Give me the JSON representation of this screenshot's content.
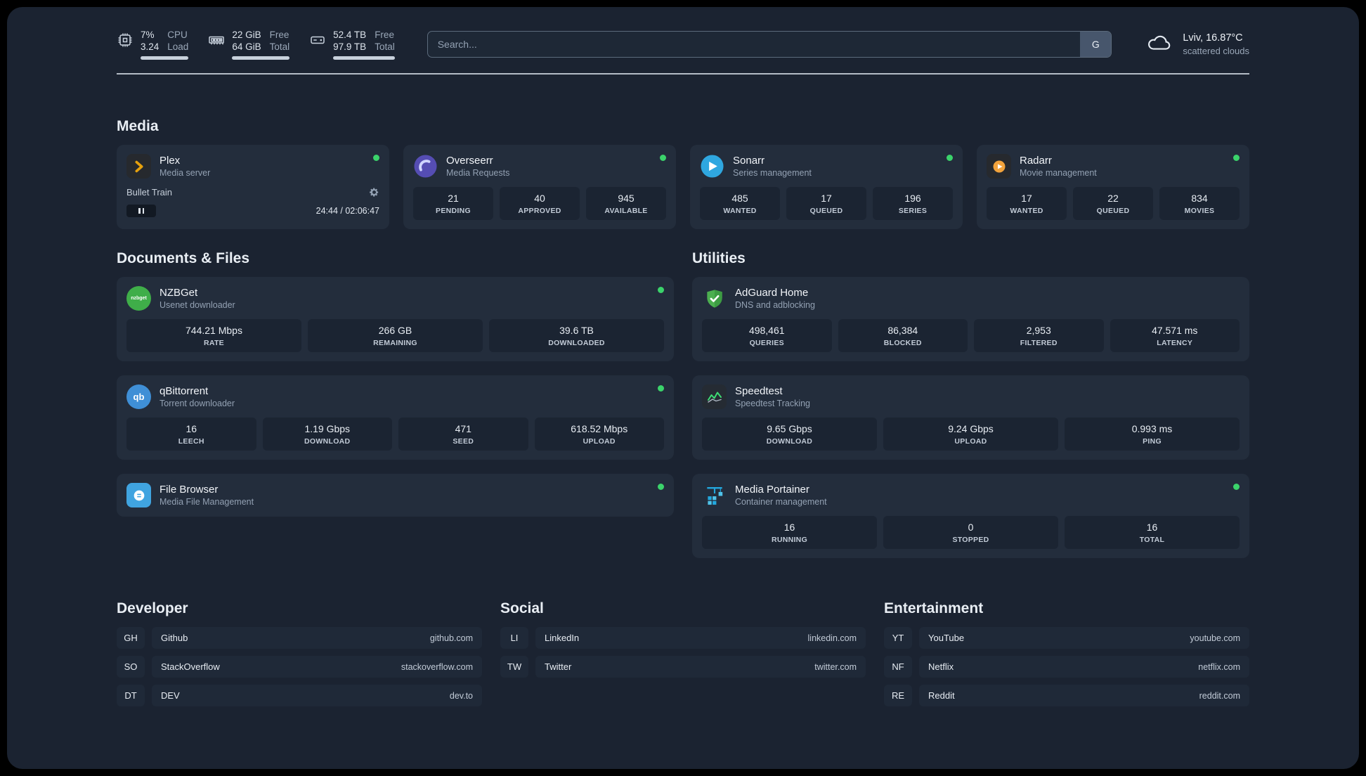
{
  "topbar": {
    "cpu": {
      "value1": "7%",
      "label1": "CPU",
      "value2": "3.24",
      "label2": "Load"
    },
    "memory": {
      "value1": "22 GiB",
      "label1": "Free",
      "value2": "64 GiB",
      "label2": "Total"
    },
    "disk": {
      "value1": "52.4 TB",
      "label1": "Free",
      "value2": "97.9 TB",
      "label2": "Total"
    },
    "search": {
      "placeholder": "Search...",
      "provider": "G"
    },
    "weather": {
      "location": "Lviv, 16.87°C",
      "condition": "scattered clouds"
    }
  },
  "colors": {
    "status_online": "#3bd36b",
    "panel_bg": "#1b2331",
    "card_bg": "#232d3c",
    "plex_accent": "#e5a00d"
  },
  "sections": {
    "media": {
      "heading": "Media",
      "cards": [
        {
          "name": "Plex",
          "subtitle": "Media server",
          "icon": "plex-icon",
          "status": "online",
          "widget": {
            "title": "Bullet Train",
            "time": "24:44 / 02:06:47"
          }
        },
        {
          "name": "Overseerr",
          "subtitle": "Media Requests",
          "icon": "overseerr-icon",
          "status": "online",
          "stats": [
            {
              "value": "21",
              "label": "PENDING"
            },
            {
              "value": "40",
              "label": "APPROVED"
            },
            {
              "value": "945",
              "label": "AVAILABLE"
            }
          ]
        },
        {
          "name": "Sonarr",
          "subtitle": "Series management",
          "icon": "sonarr-icon",
          "status": "online",
          "stats": [
            {
              "value": "485",
              "label": "WANTED"
            },
            {
              "value": "17",
              "label": "QUEUED"
            },
            {
              "value": "196",
              "label": "SERIES"
            }
          ]
        },
        {
          "name": "Radarr",
          "subtitle": "Movie management",
          "icon": "radarr-icon",
          "status": "online",
          "stats": [
            {
              "value": "17",
              "label": "WANTED"
            },
            {
              "value": "22",
              "label": "QUEUED"
            },
            {
              "value": "834",
              "label": "MOVIES"
            }
          ]
        }
      ]
    },
    "documents": {
      "heading": "Documents & Files",
      "cards": [
        {
          "name": "NZBGet",
          "subtitle": "Usenet downloader",
          "icon": "nzbget-icon",
          "status": "online",
          "stats": [
            {
              "value": "744.21 Mbps",
              "label": "RATE"
            },
            {
              "value": "266 GB",
              "label": "REMAINING"
            },
            {
              "value": "39.6 TB",
              "label": "DOWNLOADED"
            }
          ]
        },
        {
          "name": "qBittorrent",
          "subtitle": "Torrent downloader",
          "icon": "qbittorrent-icon",
          "status": "online",
          "icon_text": "qb",
          "stats": [
            {
              "value": "16",
              "label": "LEECH"
            },
            {
              "value": "1.19 Gbps",
              "label": "DOWNLOAD"
            },
            {
              "value": "471",
              "label": "SEED"
            },
            {
              "value": "618.52 Mbps",
              "label": "UPLOAD"
            }
          ]
        },
        {
          "name": "File Browser",
          "subtitle": "Media File Management",
          "icon": "filebrowser-icon",
          "status": "online"
        }
      ],
      "nzbget_icon_text": "nzbget"
    },
    "utilities": {
      "heading": "Utilities",
      "cards": [
        {
          "name": "AdGuard Home",
          "subtitle": "DNS and adblocking",
          "icon": "adguard-icon",
          "stats": [
            {
              "value": "498,461",
              "label": "QUERIES"
            },
            {
              "value": "86,384",
              "label": "BLOCKED"
            },
            {
              "value": "2,953",
              "label": "FILTERED"
            },
            {
              "value": "47.571 ms",
              "label": "LATENCY"
            }
          ]
        },
        {
          "name": "Speedtest",
          "subtitle": "Speedtest Tracking",
          "icon": "speedtest-icon",
          "stats": [
            {
              "value": "9.65 Gbps",
              "label": "DOWNLOAD"
            },
            {
              "value": "9.24 Gbps",
              "label": "UPLOAD"
            },
            {
              "value": "0.993 ms",
              "label": "PING"
            }
          ]
        },
        {
          "name": "Media Portainer",
          "subtitle": "Container management",
          "icon": "portainer-icon",
          "status": "online",
          "stats": [
            {
              "value": "16",
              "label": "RUNNING"
            },
            {
              "value": "0",
              "label": "STOPPED"
            },
            {
              "value": "16",
              "label": "TOTAL"
            }
          ]
        }
      ]
    }
  },
  "bookmarks": {
    "groups": [
      {
        "heading": "Developer",
        "items": [
          {
            "abbr": "GH",
            "name": "Github",
            "url": "github.com"
          },
          {
            "abbr": "SO",
            "name": "StackOverflow",
            "url": "stackoverflow.com"
          },
          {
            "abbr": "DT",
            "name": "DEV",
            "url": "dev.to"
          }
        ]
      },
      {
        "heading": "Social",
        "items": [
          {
            "abbr": "LI",
            "name": "LinkedIn",
            "url": "linkedin.com"
          },
          {
            "abbr": "TW",
            "name": "Twitter",
            "url": "twitter.com"
          }
        ]
      },
      {
        "heading": "Entertainment",
        "items": [
          {
            "abbr": "YT",
            "name": "YouTube",
            "url": "youtube.com"
          },
          {
            "abbr": "NF",
            "name": "Netflix",
            "url": "netflix.com"
          },
          {
            "abbr": "RE",
            "name": "Reddit",
            "url": "reddit.com"
          }
        ]
      }
    ]
  }
}
